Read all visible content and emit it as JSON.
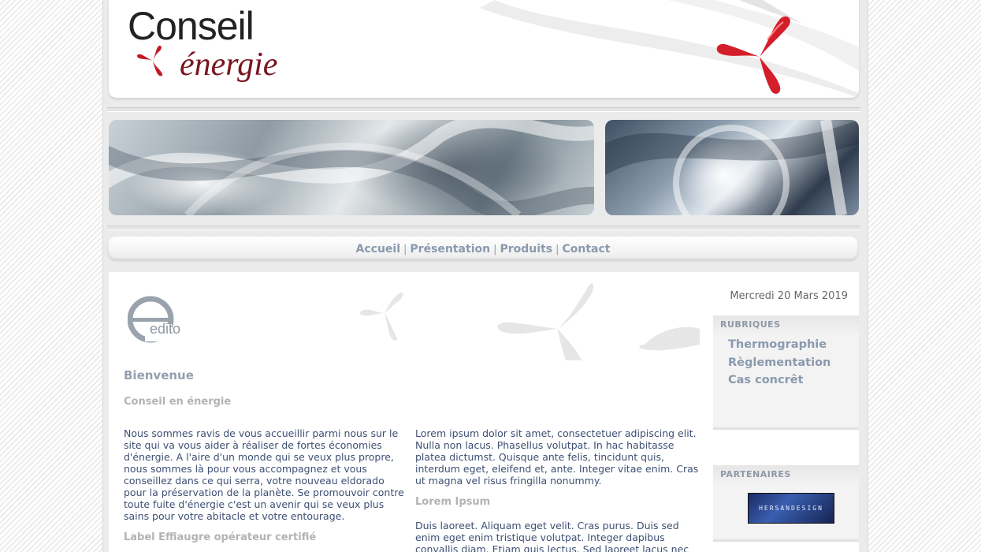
{
  "header": {
    "logo_line1": "Conseil",
    "logo_line2": "énergie"
  },
  "nav": {
    "items": [
      "Accueil",
      "Présentation",
      "Produits",
      "Contact"
    ],
    "separator": "|"
  },
  "main": {
    "edito_label": "edito",
    "title": "Bienvenue",
    "subtitle": "Conseil en énergie",
    "welcome_text": "Nous sommes ravis de vous accueillir parmi nous sur le site qui va vous aider à réaliser de fortes économies d'énergie. A l'aire d'un monde qui se veux plus propre, nous sommes là pour vous accompagnez et vous conseillez dans ce qui serra, votre nouveau eldorado pour la préservation de la planète. Se promouvoir contre toute fuite d'énergie c'est un avenir qui se veux plus sains pour votre abitacle et votre entourage.",
    "label_heading": "Label Effiaugre opérateur certifié",
    "lorem_text_1": "Lorem ipsum dolor sit amet, consectetuer adipiscing elit. Nulla non lacus. Phasellus volutpat. In hac habitasse platea dictumst. Quisque ante felis, tincidunt quis, interdum eget, eleifend et, ante. Integer vitae enim. Cras ut magna vel risus fringilla nonummy.",
    "lorem_heading": "Lorem Ipsum",
    "lorem_text_2": "Duis laoreet. Aliquam eget velit. Cras purus. Duis sed enim eget enim tristique volutpat. Integer dapibus convallis diam. Etiam quis lectus. Sed laoreet lacus nec"
  },
  "sidebar": {
    "date": "Mercredi 20 Mars 2019",
    "rubriques_title": "RUBRIQUES",
    "rubriques": [
      "Thermographie",
      "Règlementation",
      "Cas concrêt"
    ],
    "partenaires_title": "PARTENAIRES",
    "partner_logo_text": "HERSANDESIGN"
  },
  "colors": {
    "nav_link": "#8a9aae",
    "body_text": "#3d4f73",
    "brand_red": "#d41f2b"
  }
}
